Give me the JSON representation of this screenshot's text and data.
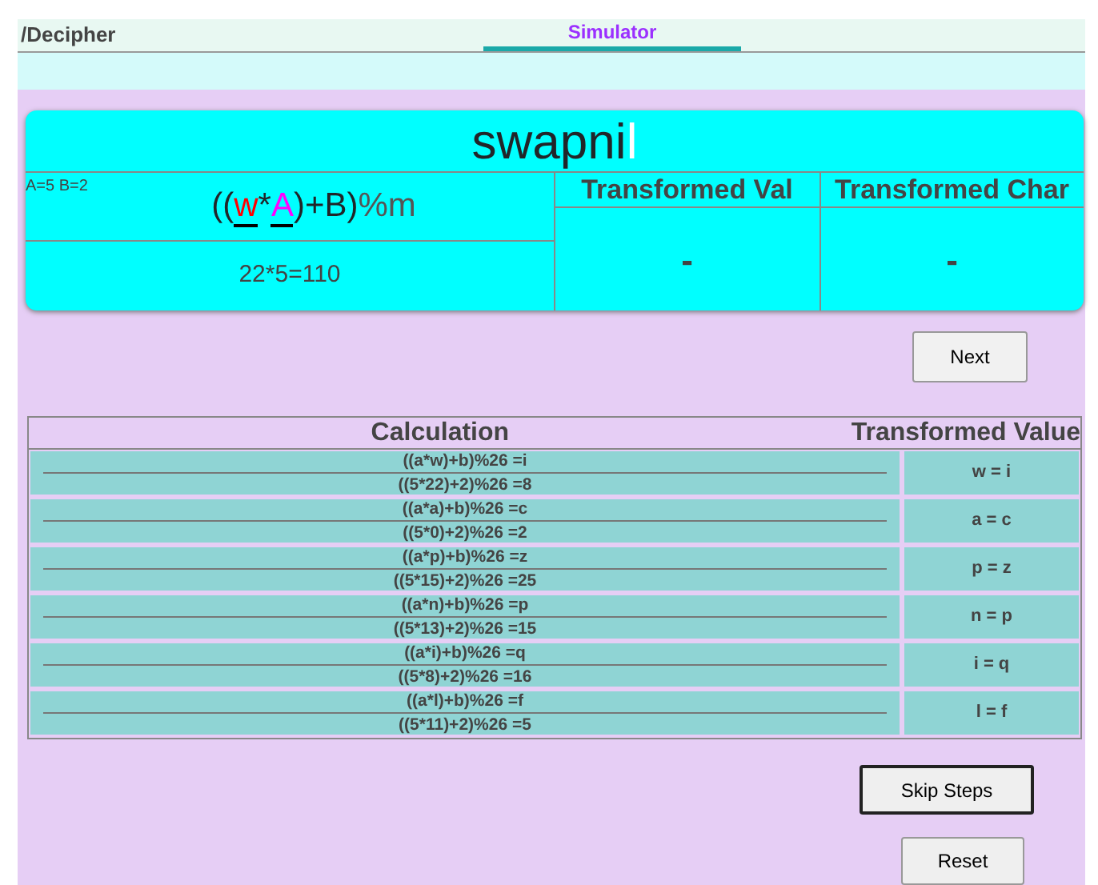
{
  "nav": {
    "left": "/Decipher",
    "tabs": [
      {
        "label": "Simulator",
        "selected": true
      }
    ]
  },
  "word": [
    {
      "ch": "s",
      "current": false
    },
    {
      "ch": "w",
      "current": false
    },
    {
      "ch": "a",
      "current": false
    },
    {
      "ch": "p",
      "current": false
    },
    {
      "ch": "n",
      "current": false
    },
    {
      "ch": "i",
      "current": false
    },
    {
      "ch": "l",
      "current": true
    }
  ],
  "keys": "A=5  B=2",
  "formula": [
    {
      "text": "((",
      "kind": "plain"
    },
    {
      "text": "w",
      "kind": "var",
      "color": "#ff0000"
    },
    {
      "text": "*",
      "kind": "plain"
    },
    {
      "text": "A",
      "kind": "var",
      "color": "#ff00ff"
    },
    {
      "text": ")+B)",
      "kind": "plain"
    },
    {
      "text": "%m",
      "kind": "mod"
    }
  ],
  "product": "22*5=110",
  "result_columns": [
    {
      "header": "Transformed Val",
      "value": "-"
    },
    {
      "header": "Transformed Char",
      "value": "-"
    }
  ],
  "next_button": "Next",
  "table": {
    "columns": [
      "Calculation",
      "Transformed Value"
    ],
    "rows": [
      {
        "formula": "((a*w)+b)%26 =i",
        "numeric": "((5*22)+2)%26 =8",
        "value": "w = i"
      },
      {
        "formula": "((a*a)+b)%26 =c",
        "numeric": "((5*0)+2)%26 =2",
        "value": "a = c"
      },
      {
        "formula": "((a*p)+b)%26 =z",
        "numeric": "((5*15)+2)%26 =25",
        "value": "p = z"
      },
      {
        "formula": "((a*n)+b)%26 =p",
        "numeric": "((5*13)+2)%26 =15",
        "value": "n = p"
      },
      {
        "formula": "((a*i)+b)%26 =q",
        "numeric": "((5*8)+2)%26 =16",
        "value": "i = q"
      },
      {
        "formula": "((a*l)+b)%26 =f",
        "numeric": "((5*11)+2)%26 =5",
        "value": "l = f"
      }
    ]
  },
  "skip_button": "Skip Steps",
  "reset_button": "Reset"
}
